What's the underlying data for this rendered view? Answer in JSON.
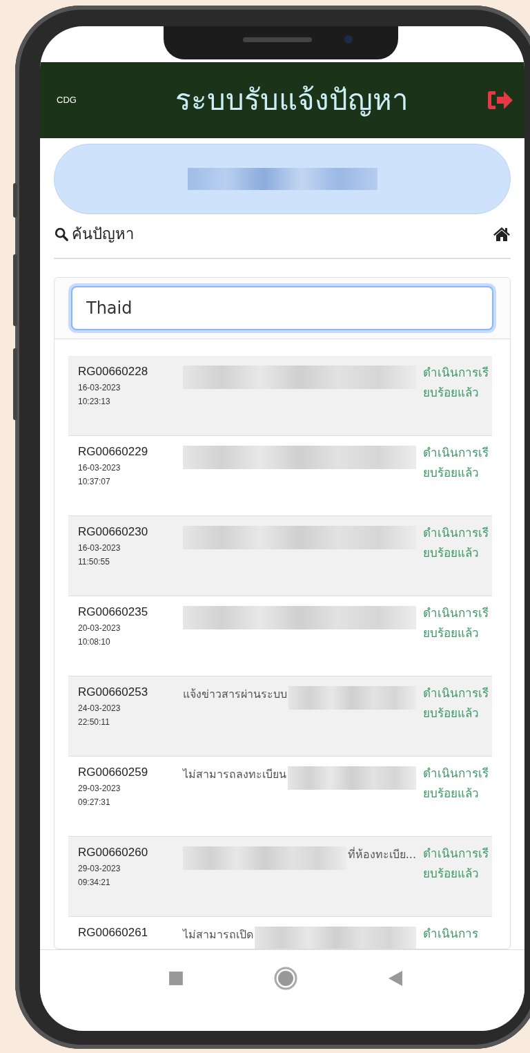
{
  "header": {
    "logo": "CDG",
    "title": "ระบบรับแจ้งปัญหา"
  },
  "user_banner": {
    "parts": [
      {
        "kind": "redacted"
      }
    ]
  },
  "section": {
    "title": "ค้นปัญหา"
  },
  "search": {
    "value": "Thaid"
  },
  "tickets": [
    {
      "id": "RG00660228",
      "date": "16-03-2023",
      "time": "10:23:13",
      "description": [
        {
          "kind": "redacted"
        }
      ],
      "status": "ดำเนินการเรียบร้อยแล้ว"
    },
    {
      "id": "RG00660229",
      "date": "16-03-2023",
      "time": "10:37:07",
      "description": [
        {
          "kind": "redacted"
        }
      ],
      "status": "ดำเนินการเรียบร้อยแล้ว"
    },
    {
      "id": "RG00660230",
      "date": "16-03-2023",
      "time": "11:50:55",
      "description": [
        {
          "kind": "redacted"
        }
      ],
      "status": "ดำเนินการเรียบร้อยแล้ว"
    },
    {
      "id": "RG00660235",
      "date": "20-03-2023",
      "time": "10:08:10",
      "description": [
        {
          "kind": "redacted"
        }
      ],
      "status": "ดำเนินการเรียบร้อยแล้ว"
    },
    {
      "id": "RG00660253",
      "date": "24-03-2023",
      "time": "22:50:11",
      "description": [
        {
          "kind": "text",
          "text": "แจ้งข่าวสารผ่านระบบ"
        },
        {
          "kind": "redacted"
        }
      ],
      "status": "ดำเนินการเรียบร้อยแล้ว"
    },
    {
      "id": "RG00660259",
      "date": "29-03-2023",
      "time": "09:27:31",
      "description": [
        {
          "kind": "text",
          "text": "ไม่สามารถลงทะเบียน"
        },
        {
          "kind": "redacted"
        }
      ],
      "status": "ดำเนินการเรียบร้อยแล้ว"
    },
    {
      "id": "RG00660260",
      "date": "29-03-2023",
      "time": "09:34:21",
      "description": [
        {
          "kind": "redacted"
        },
        {
          "kind": "text",
          "text": "ที่ห้องทะเบีย..."
        }
      ],
      "status": "ดำเนินการเรียบร้อยแล้ว"
    },
    {
      "id": "RG00660261",
      "description": [
        {
          "kind": "text",
          "text": "ไม่สามารถเปิด"
        },
        {
          "kind": "redacted"
        }
      ],
      "status": "ดำเนินการ"
    }
  ]
}
